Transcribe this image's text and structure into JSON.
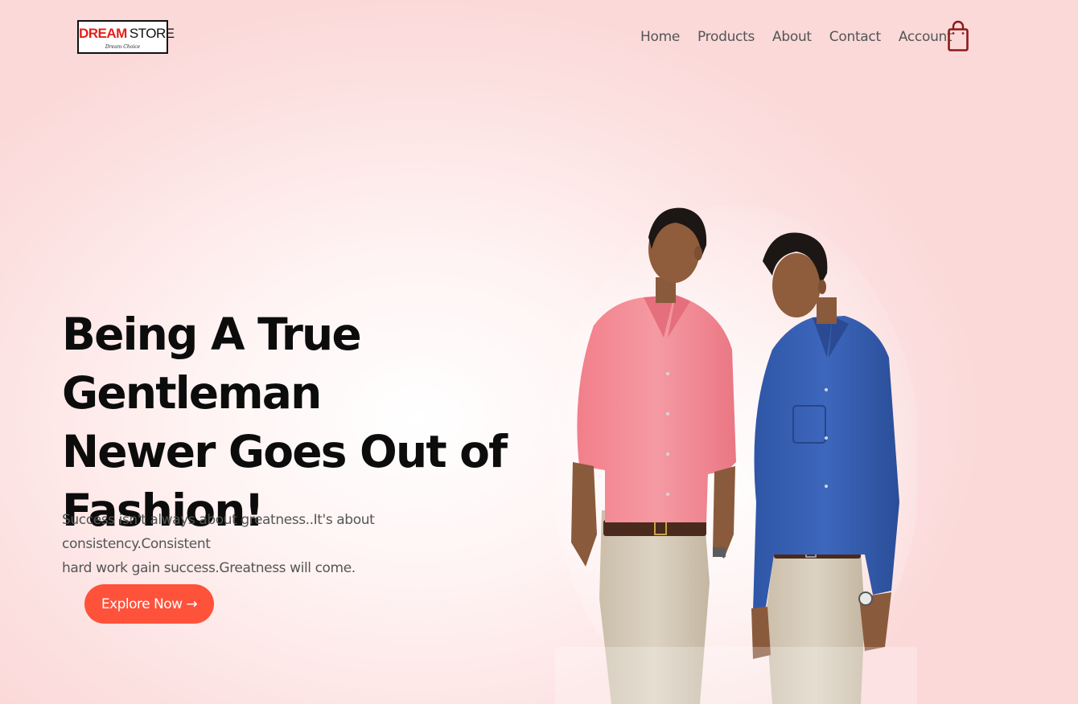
{
  "brand": {
    "name_part1": "DREAM",
    "name_part2": "STORE",
    "tagline": "Dream Choice"
  },
  "nav": {
    "items": [
      {
        "label": "Home"
      },
      {
        "label": "Products"
      },
      {
        "label": "About"
      },
      {
        "label": "Contact"
      },
      {
        "label": "Account"
      }
    ],
    "cart_icon": "shopping-bag-icon"
  },
  "hero": {
    "headline_lines": [
      "Being A True Gentleman",
      "Newer Goes Out of",
      "Fashion!"
    ],
    "subtext_lines": [
      "Success isn't always about greatness..It's about consistency.Consistent",
      "hard work gain success.Greatness will come."
    ],
    "cta_label": "Explore Now →",
    "image": "two-men-in-shirts-photo"
  },
  "colors": {
    "accent": "#ff523b",
    "brand_red": "#e3211b",
    "cart_icon": "#8b1a1a",
    "text_dark": "#0c0c0c",
    "text_muted": "#555555"
  }
}
